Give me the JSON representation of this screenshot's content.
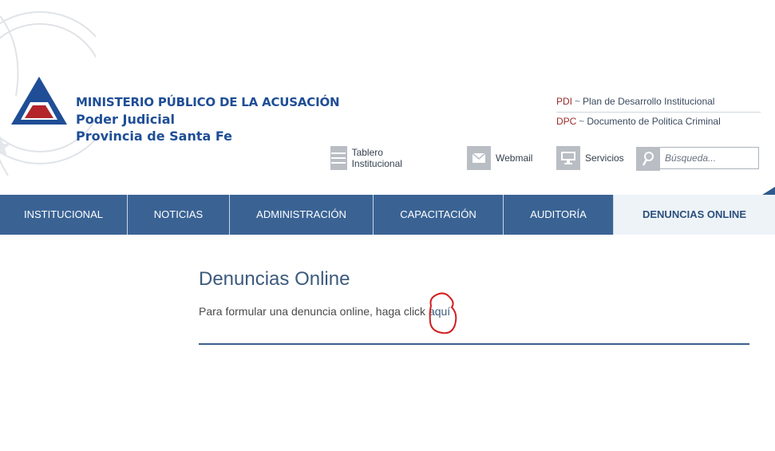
{
  "brand": {
    "line1": "MINISTERIO PÚBLICO DE LA ACUSACIÓN",
    "line2": "Poder Judicial",
    "line3": "Provincia de Santa Fe"
  },
  "quick_links": [
    {
      "code": "PDI",
      "sep": "~",
      "label": "Plan de Desarrollo Institucional"
    },
    {
      "code": "DPC",
      "sep": "~",
      "label": "Documento de Politica Criminal"
    }
  ],
  "utility": {
    "tablero": "Tablero Institucional",
    "webmail": "Webmail",
    "servicios": "Servicios"
  },
  "search": {
    "placeholder": "Búsqueda..."
  },
  "nav": {
    "items": [
      {
        "label": "INSTITUCIONAL"
      },
      {
        "label": "NOTICIAS"
      },
      {
        "label": "ADMINISTRACIÓN"
      },
      {
        "label": "CAPACITACIÓN"
      },
      {
        "label": "AUDITORÍA"
      },
      {
        "label": "DENUNCIAS ONLINE"
      }
    ],
    "active": "DENUNCIAS ONLINE"
  },
  "content": {
    "title": "Denuncias Online",
    "text": "Para formular una denuncia online, haga click",
    "link": "aquí"
  },
  "colors": {
    "nav_bg": "#3a6394",
    "brand": "#1f4e96",
    "accent_red": "#9b2a2a"
  }
}
